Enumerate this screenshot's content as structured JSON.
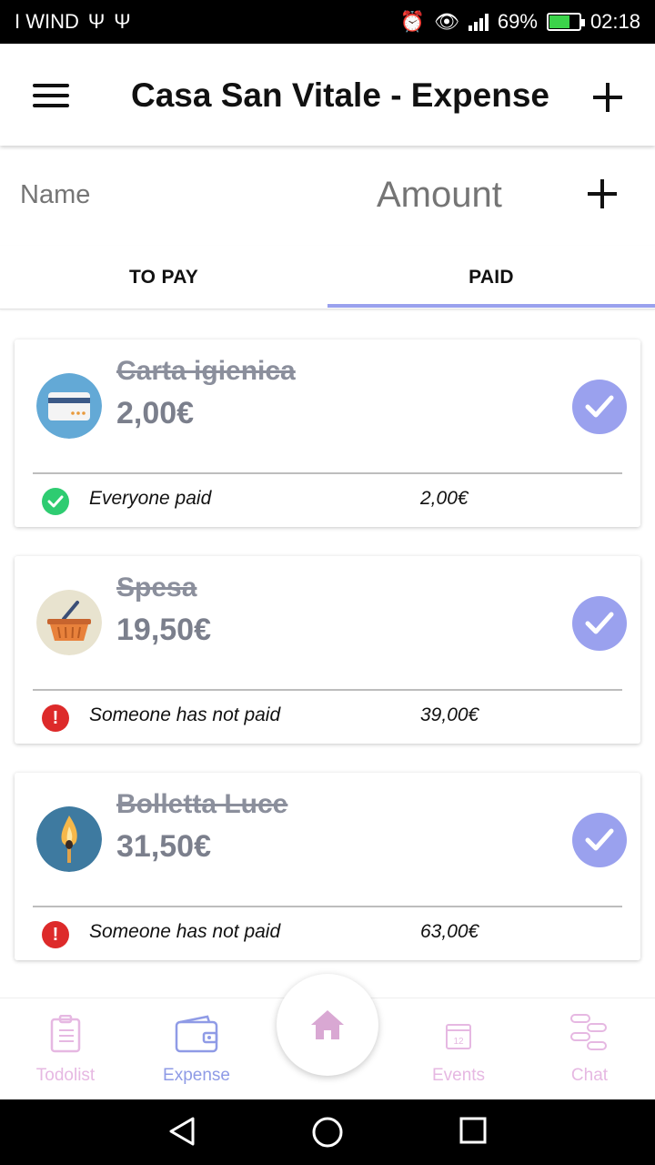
{
  "status_bar": {
    "carrier": "I WIND",
    "battery_percent": "69%",
    "battery_level": 0.69,
    "time": "02:18"
  },
  "app_bar": {
    "title": "Casa San Vitale - Expense",
    "menu_icon": "hamburger-menu-icon",
    "add_icon": "plus-icon"
  },
  "input_row": {
    "name_placeholder": "Name",
    "amount_placeholder": "Amount",
    "add_icon": "plus-icon"
  },
  "tabs": {
    "items": [
      {
        "label": "TO PAY"
      },
      {
        "label": "PAID"
      }
    ],
    "selected": "PAID"
  },
  "expenses": [
    {
      "name": "Carta igienica",
      "amount": "2,00€",
      "icon": "credit-card-icon",
      "status_icon": "check-circle-icon",
      "status_text": "Everyone paid",
      "status_total": "2,00€"
    },
    {
      "name": "Spesa",
      "amount": "19,50€",
      "icon": "shopping-basket-icon",
      "status_icon": "alert-circle-icon",
      "status_text": "Someone has not paid",
      "status_total": "39,00€"
    },
    {
      "name": "Bolletta Luce",
      "amount": "31,50€",
      "icon": "match-flame-icon",
      "status_icon": "alert-circle-icon",
      "status_text": "Someone has not paid",
      "status_total": "63,00€"
    }
  ],
  "bottom_nav": {
    "items": [
      {
        "label": "Todolist",
        "icon": "clipboard-icon"
      },
      {
        "label": "Expense",
        "icon": "wallet-icon"
      },
      {
        "label": "Events",
        "icon": "calendar-icon",
        "date_text": "12"
      },
      {
        "label": "Chat",
        "icon": "chat-bubbles-icon"
      }
    ],
    "home_icon": "home-icon"
  },
  "colors": {
    "accent": "#9aa1ee",
    "ok": "#2ecc71",
    "warn": "#dd2a2a",
    "nav_inactive": "#e6b8e2",
    "nav_active": "#8f9be6",
    "home": "#d9a8d3"
  }
}
